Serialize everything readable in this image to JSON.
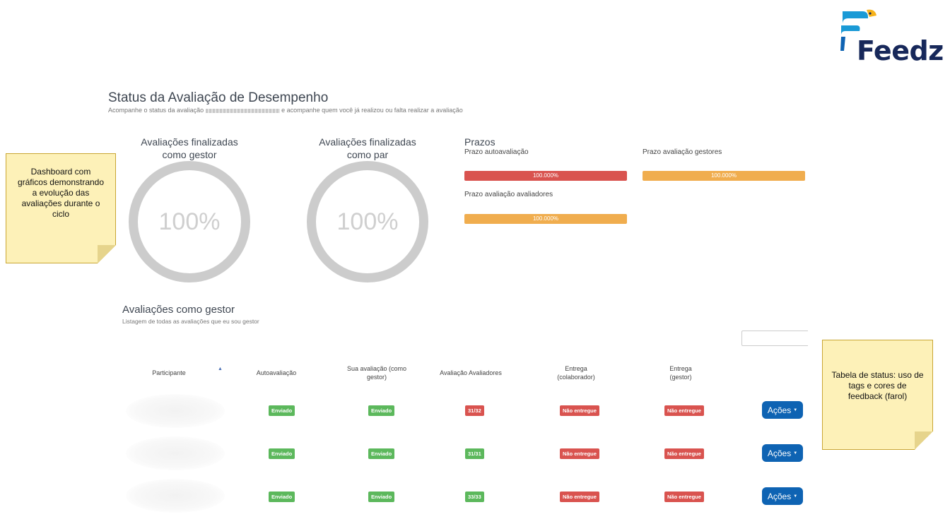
{
  "logo": {
    "text": "Feedz",
    "colors": {
      "bird_blue": "#1a9ad6",
      "bird_yellow": "#f6b21a",
      "text": "#17285a"
    }
  },
  "header": {
    "title": "Status da Avaliação de Desempenho",
    "subtitle_before": "Acompanhe o status da avaliação",
    "subtitle_after": "e acompanhe quem você já realizou ou falta realizar a avaliação"
  },
  "donuts": [
    {
      "title_line1": "Avaliações finalizadas",
      "title_line2": "como gestor",
      "value": "100%"
    },
    {
      "title_line1": "Avaliações finalizadas",
      "title_line2": "como par",
      "value": "100%"
    }
  ],
  "prazos": {
    "title": "Prazos",
    "items": [
      {
        "label": "Prazo autoavaliação",
        "value": "100.000%",
        "color": "#d9534f"
      },
      {
        "label": "Prazo avaliação gestores",
        "value": "100.000%",
        "color": "#f0ad4e"
      },
      {
        "label": "Prazo avaliação avaliadores",
        "value": "100.000%",
        "color": "#f0ad4e"
      }
    ]
  },
  "section": {
    "title": "Avaliações como gestor",
    "subtitle": "Listagem de todas as avaliações que eu sou gestor",
    "search_value": ""
  },
  "table": {
    "columns": {
      "participante": "Participante",
      "autoavaliacao": "Autoavaliação",
      "sua_avaliacao_1": "Sua avaliação (como",
      "sua_avaliacao_2": "gestor)",
      "avaliadores": "Avaliação Avaliadores",
      "entrega_colab_1": "Entrega",
      "entrega_colab_2": "(colaborador)",
      "entrega_gestor_1": "Entrega",
      "entrega_gestor_2": "(gestor)"
    },
    "rows": [
      {
        "autoavaliacao": "Enviado",
        "sua_avaliacao": "Enviado",
        "avaliadores": "31/32",
        "entrega_colab": "Não entregue",
        "entrega_gestor": "Não entregue",
        "acoes": "Ações"
      },
      {
        "autoavaliacao": "Enviado",
        "sua_avaliacao": "Enviado",
        "avaliadores": "31/31",
        "entrega_colab": "Não entregue",
        "entrega_gestor": "Não entregue",
        "acoes": "Ações"
      },
      {
        "autoavaliacao": "Enviado",
        "sua_avaliacao": "Enviado",
        "avaliadores": "33/33",
        "entrega_colab": "Não entregue",
        "entrega_gestor": "Não entregue",
        "acoes": "Ações"
      }
    ]
  },
  "notes": [
    {
      "text": "Dashboard com gráficos demonstrando a evolução das avaliações durante o ciclo"
    },
    {
      "text": "Tabela de status: uso de tags e cores de feedback (farol)"
    }
  ]
}
